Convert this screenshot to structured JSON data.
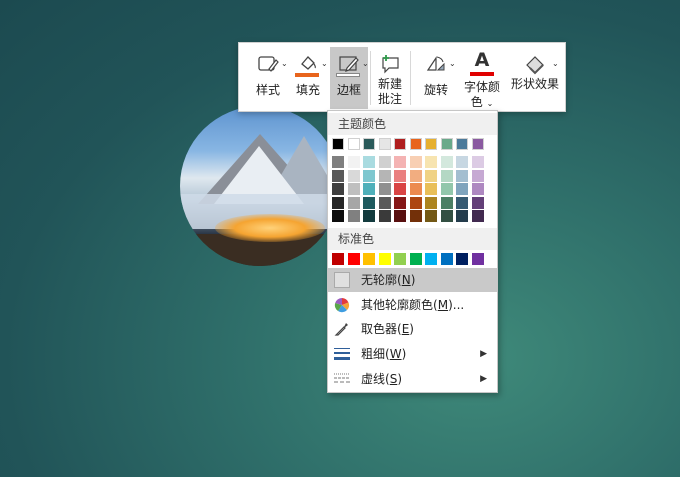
{
  "toolbar": {
    "style_label": "样式",
    "fill_label": "填充",
    "fill_color": "#e8641c",
    "border_label": "边框",
    "new_comment_line1": "新建",
    "new_comment_line2": "批注",
    "rotate_label": "旋转",
    "font_color_line1": "字体颜",
    "font_color_line2": "色",
    "font_color": "#e00000",
    "shape_effect_label": "形状效果"
  },
  "menu": {
    "theme_colors_label": "主题颜色",
    "standard_colors_label": "标准色",
    "theme_colors": [
      "#000000",
      "#ffffff",
      "#2a5a5a",
      "#e6e6e6",
      "#b01f1f",
      "#e8641c",
      "#e6b030",
      "#6aa98a",
      "#4c7a9a",
      "#8a5aa0"
    ],
    "theme_shades": [
      [
        "#7f7f7f",
        "#595959",
        "#3f3f3f",
        "#262626",
        "#0d0d0d"
      ],
      [
        "#f2f2f2",
        "#d9d9d9",
        "#bfbfbf",
        "#a6a6a6",
        "#808080"
      ],
      [
        "#a9dbe0",
        "#7ec7cf",
        "#4fb0ba",
        "#1e5a5e",
        "#133b3e"
      ],
      [
        "#d0d0d0",
        "#b5b5b5",
        "#909090",
        "#5a5a5a",
        "#3a3a3a"
      ],
      [
        "#f4b3b3",
        "#ea7f7f",
        "#d94444",
        "#851616",
        "#580f0f"
      ],
      [
        "#f8cfb3",
        "#f2ad80",
        "#ec8a4f",
        "#ad4612",
        "#733009"
      ],
      [
        "#f7e4b0",
        "#f0d284",
        "#e9bf58",
        "#ac8420",
        "#735815"
      ],
      [
        "#d3e8dd",
        "#b4d8c4",
        "#92c7ab",
        "#4c7f64",
        "#334f42"
      ],
      [
        "#c7d7e2",
        "#a3bed0",
        "#7fa4bd",
        "#365a72",
        "#243c4c"
      ],
      [
        "#dccbe4",
        "#c6a9d3",
        "#ae88c1",
        "#633f78",
        "#422a50"
      ]
    ],
    "standard_colors": [
      "#c00000",
      "#ff0000",
      "#ffc000",
      "#ffff00",
      "#92d050",
      "#00b050",
      "#00b0f0",
      "#0070c0",
      "#002060",
      "#7030a0"
    ],
    "no_outline": "无轮廓",
    "no_outline_key": "N",
    "more_colors": "其他轮廓颜色",
    "more_colors_key": "M",
    "more_colors_suffix": "...",
    "eyedropper": "取色器",
    "eyedropper_key": "E",
    "weight": "粗细",
    "weight_key": "W",
    "dashes": "虚线",
    "dashes_key": "S"
  }
}
